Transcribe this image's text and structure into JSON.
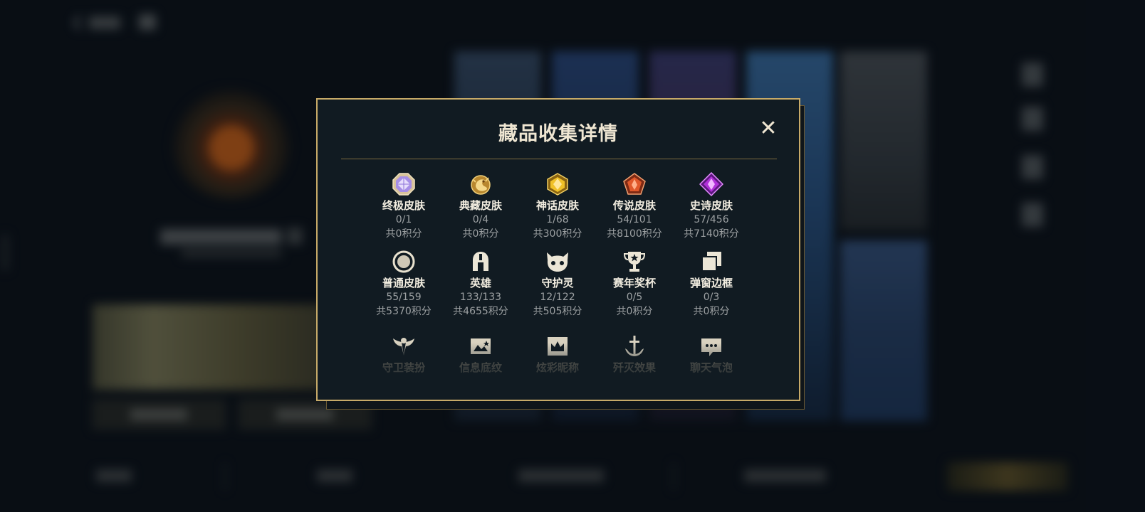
{
  "modal": {
    "title": "藏品收集详情",
    "close_symbol": "✕",
    "items": [
      {
        "name": "终极皮肤",
        "count": "0/1",
        "points": "共0积分",
        "icon": "octagon-gem-icon"
      },
      {
        "name": "典藏皮肤",
        "count": "0/4",
        "points": "共0积分",
        "icon": "dragon-emblem-icon"
      },
      {
        "name": "神话皮肤",
        "count": "1/68",
        "points": "共300积分",
        "icon": "hexagon-gem-icon"
      },
      {
        "name": "传说皮肤",
        "count": "54/101",
        "points": "共8100积分",
        "icon": "pentagon-gem-icon"
      },
      {
        "name": "史诗皮肤",
        "count": "57/456",
        "points": "共7140积分",
        "icon": "diamond-gem-icon"
      },
      {
        "name": "普通皮肤",
        "count": "55/159",
        "points": "共5370积分",
        "icon": "ring-icon"
      },
      {
        "name": "英雄",
        "count": "133/133",
        "points": "共4655积分",
        "icon": "helmet-icon"
      },
      {
        "name": "守护灵",
        "count": "12/122",
        "points": "共505积分",
        "icon": "spirit-pet-icon"
      },
      {
        "name": "赛年奖杯",
        "count": "0/5",
        "points": "共0积分",
        "icon": "trophy-icon"
      },
      {
        "name": "弹窗边框",
        "count": "0/3",
        "points": "共0积分",
        "icon": "frame-stack-icon"
      },
      {
        "name": "守卫装扮",
        "icon": "ward-icon"
      },
      {
        "name": "信息底纹",
        "icon": "info-card-icon"
      },
      {
        "name": "炫彩昵称",
        "icon": "crown-nameplate-icon"
      },
      {
        "name": "歼灭效果",
        "icon": "anchor-sword-icon"
      },
      {
        "name": "聊天气泡",
        "icon": "chat-bubble-icon"
      }
    ]
  },
  "colors": {
    "modal_border": "#c7aa68",
    "modal_bg": "#111b22",
    "title": "#efe6d2",
    "subtext": "#9da1a3",
    "gold_icon": "#d8b456",
    "epic_purple": "#b02fd8",
    "legend_orange": "#e0582a",
    "ultimate_violet": "#b8a6f0"
  }
}
